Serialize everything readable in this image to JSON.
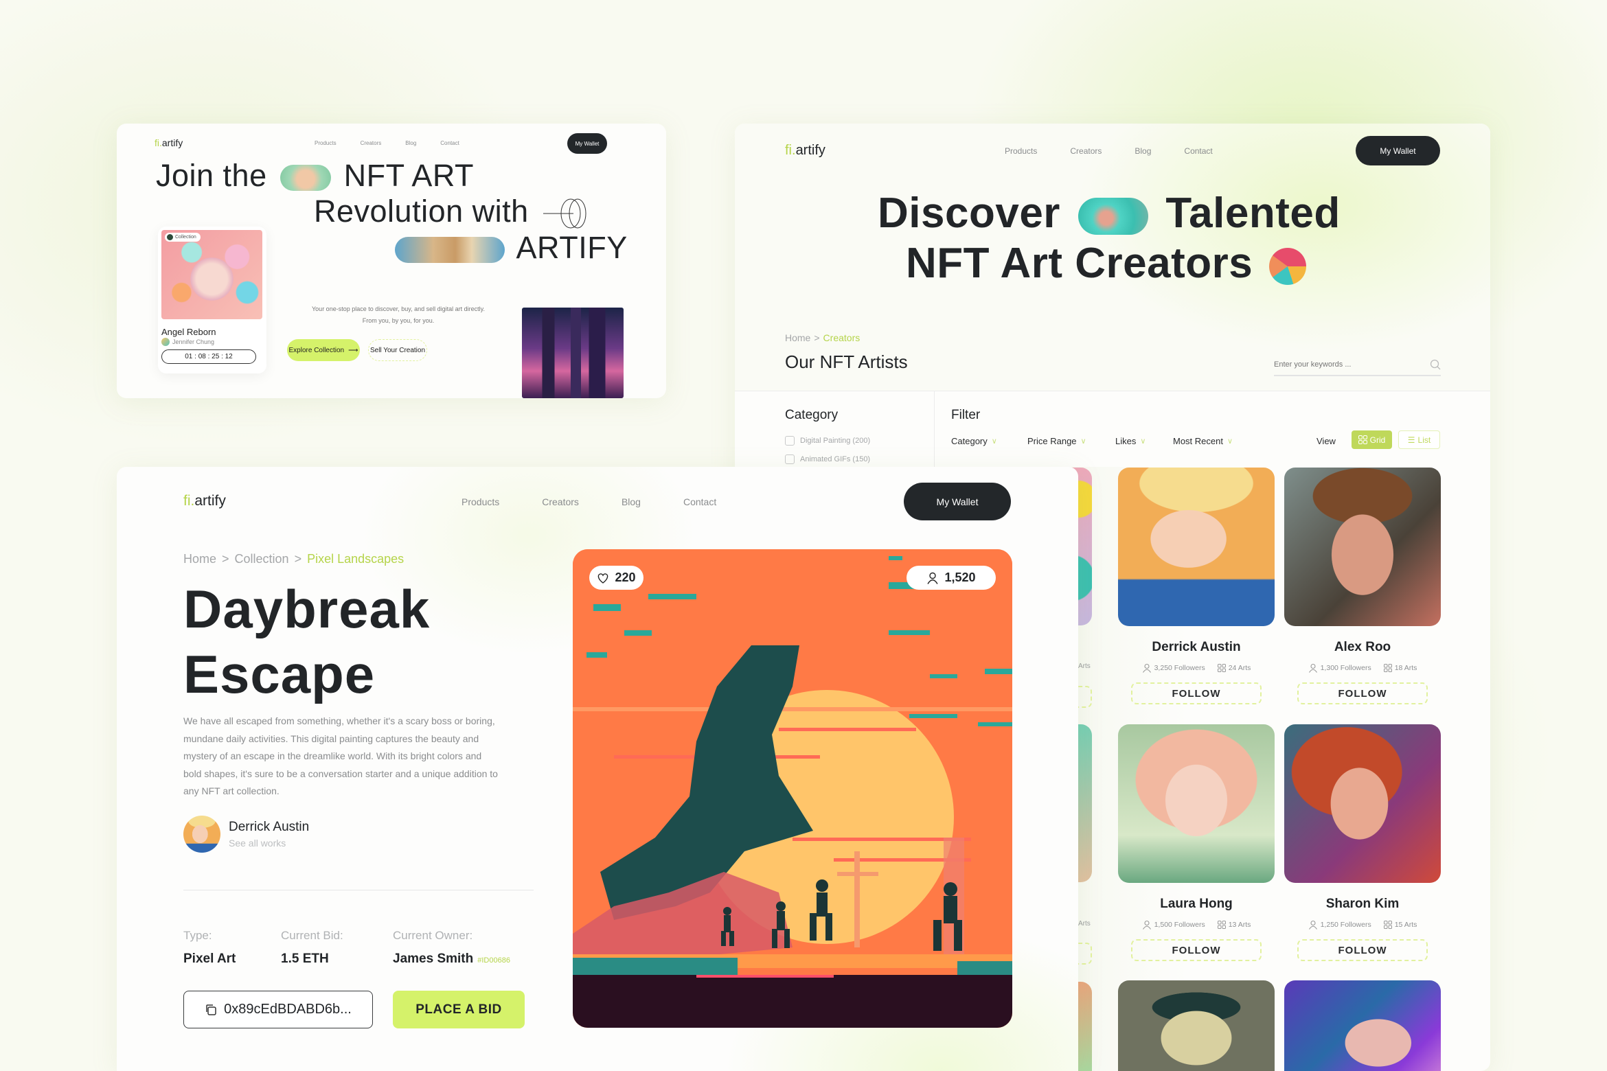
{
  "brand": {
    "logo_prefix": "fi.",
    "logo_name": "artify",
    "accent_color": "#b5d44a",
    "button_accent": "#d5f26a",
    "dark": "#23272a"
  },
  "nav": {
    "links": [
      "Products",
      "Creators",
      "Blog",
      "Contact"
    ],
    "wallet_label": "My Wallet"
  },
  "landing": {
    "hero_line1_a": "Join the",
    "hero_line1_b": "NFT ART",
    "hero_line2": "Revolution with",
    "hero_line3": "ARTIFY",
    "tagline_1": "Your one-stop place to discover, buy, and sell digital art directly.",
    "tagline_2": "From you, by you, for you.",
    "explore_label": "Explore Collection",
    "sell_label": "Sell Your Creation",
    "card": {
      "badge": "Collection",
      "title": "Angel Reborn",
      "author": "Jennifer Chung",
      "countdown": "01 : 08 : 25 : 12"
    }
  },
  "creators": {
    "hero_line1_a": "Discover",
    "hero_line1_b": "Talented",
    "hero_line2": "NFT Art Creators",
    "breadcrumb": {
      "home": "Home",
      "sep": ">",
      "current": "Creators"
    },
    "title": "Our NFT Artists",
    "search_placeholder": "Enter your keywords ...",
    "category_heading": "Category",
    "categories": [
      {
        "label": "Digital Painting (200)",
        "checked": false
      },
      {
        "label": "Animated GIFs (150)",
        "checked": false
      }
    ],
    "filter_heading": "Filter",
    "filters": [
      "Category",
      "Price Range",
      "Likes",
      "Most Recent"
    ],
    "view_label": "View",
    "view_grid": "Grid",
    "view_list": "List",
    "view_selected": "Grid",
    "partial_stat": "Arts",
    "artists": [
      {
        "name": "Derrick Austin",
        "followers": "3,250 Followers",
        "arts": "24 Arts",
        "follow": "FOLLOW"
      },
      {
        "name": "Alex Roo",
        "followers": "1,300 Followers",
        "arts": "18 Arts",
        "follow": "FOLLOW"
      },
      {
        "name": "Laura Hong",
        "followers": "1,500 Followers",
        "arts": "13 Arts",
        "follow": "FOLLOW"
      },
      {
        "name": "Sharon Kim",
        "followers": "1,250 Followers",
        "arts": "15 Arts",
        "follow": "FOLLOW"
      }
    ]
  },
  "detail": {
    "breadcrumb": {
      "home": "Home",
      "collection": "Collection",
      "sep": ">",
      "current": "Pixel Landscapes"
    },
    "title_line1": "Daybreak",
    "title_line2": "Escape",
    "description": "We have all escaped from something, whether it's a scary boss or boring, mundane daily activities. This digital painting captures the beauty and mystery of an escape in the dreamlike world. With its bright colors and bold shapes, it's sure to be a conversation starter and a unique addition to any NFT art collection.",
    "artist_name": "Derrick Austin",
    "artist_link": "See all works",
    "type_label": "Type:",
    "type_value": "Pixel Art",
    "bid_label": "Current Bid:",
    "bid_value": "1.5 ETH",
    "owner_label": "Current Owner:",
    "owner_value": "James Smith",
    "owner_id": "#ID00686",
    "address": "0x89cEdBDABD6b...",
    "place_bid": "PLACE A BID",
    "likes": "220",
    "views": "1,520"
  }
}
